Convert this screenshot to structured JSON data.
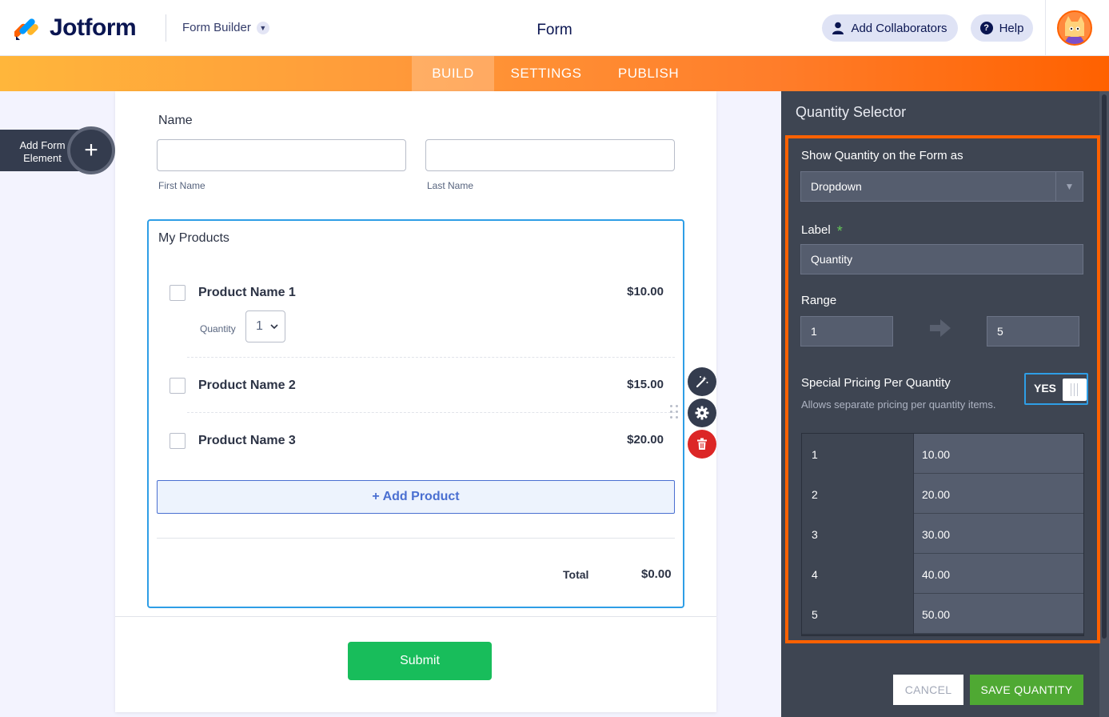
{
  "header": {
    "brand": "Jotform",
    "builder_menu": "Form Builder",
    "form_title": "Form",
    "add_collaborators": "Add Collaborators",
    "help": "Help"
  },
  "nav": {
    "tabs": [
      "BUILD",
      "SETTINGS",
      "PUBLISH"
    ],
    "active": "BUILD"
  },
  "sidebar": {
    "add_form_element": "Add Form Element"
  },
  "form": {
    "name_label": "Name",
    "first_name_sublabel": "First Name",
    "last_name_sublabel": "Last Name",
    "products_label": "My Products",
    "products": [
      {
        "name": "Product Name 1",
        "price": "$10.00"
      },
      {
        "name": "Product Name 2",
        "price": "$15.00"
      },
      {
        "name": "Product Name 3",
        "price": "$20.00"
      }
    ],
    "quantity_label": "Quantity",
    "quantity_value": "1",
    "add_product": "+ Add Product",
    "total_label": "Total",
    "total_value": "$0.00",
    "submit": "Submit"
  },
  "panel": {
    "title": "Quantity Selector",
    "show_as_label": "Show Quantity on the Form as",
    "show_as_value": "Dropdown",
    "label_label": "Label",
    "label_value": "Quantity",
    "range_label": "Range",
    "range_from": "1",
    "range_to": "5",
    "special_pricing_label": "Special Pricing Per Quantity",
    "special_pricing_desc": "Allows separate pricing per quantity items.",
    "special_pricing_toggle": "YES",
    "pricing_rows": [
      {
        "qty": "1",
        "price": "10.00"
      },
      {
        "qty": "2",
        "price": "20.00"
      },
      {
        "qty": "3",
        "price": "30.00"
      },
      {
        "qty": "4",
        "price": "40.00"
      },
      {
        "qty": "5",
        "price": "50.00"
      }
    ],
    "cancel": "CANCEL",
    "save": "SAVE QUANTITY"
  },
  "colors": {
    "brand_orange": "#ff6100",
    "accent_blue": "#2e9ee6",
    "submit_green": "#18bd5b",
    "save_green": "#4fa933",
    "delete_red": "#dc2626",
    "panel_bg": "#3e4552"
  },
  "icons": {
    "logo": "jotform-logo-icon",
    "collaborators": "user-icon",
    "help": "question-icon",
    "properties": "magic-wand-icon",
    "settings": "gear-icon",
    "delete": "trash-icon",
    "range": "arrow-right-icon",
    "dropdown": "caret-down-icon"
  }
}
